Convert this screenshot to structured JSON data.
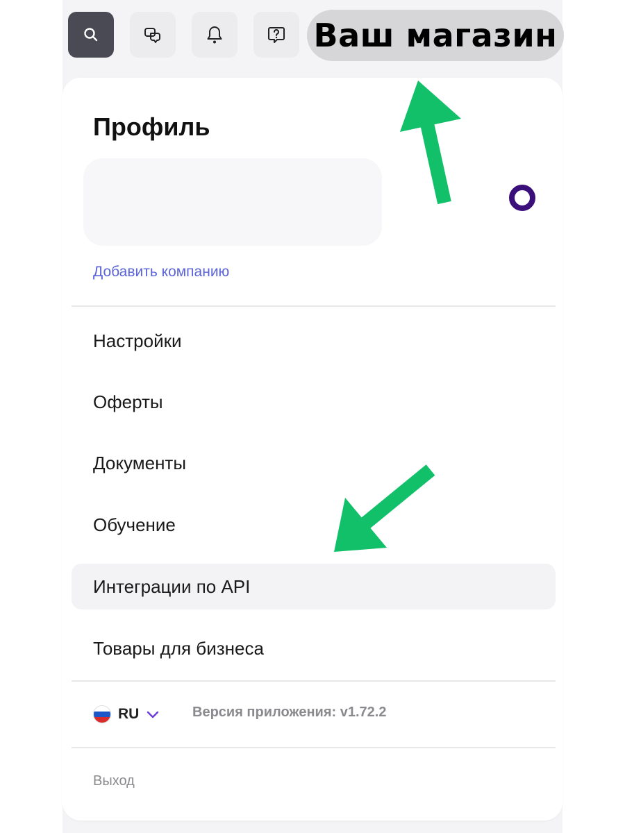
{
  "topbar": {
    "icons": [
      "search-icon",
      "chat-icon",
      "bell-icon",
      "help-icon"
    ],
    "store_label": "Ваш магазин"
  },
  "profile": {
    "title": "Профиль",
    "add_company": "Добавить компанию"
  },
  "menu": {
    "items": [
      {
        "label": "Настройки",
        "highlighted": false
      },
      {
        "label": "Оферты",
        "highlighted": false
      },
      {
        "label": "Документы",
        "highlighted": false
      },
      {
        "label": "Обучение",
        "highlighted": false
      },
      {
        "label": "Интеграции по API",
        "highlighted": true
      },
      {
        "label": "Товары для бизнеса",
        "highlighted": false
      }
    ]
  },
  "footer": {
    "language": "RU",
    "version": "Версия приложения: v1.72.2",
    "logout": "Выход"
  },
  "colors": {
    "accent_link": "#5b64d8",
    "status_ring": "#3b0f7a",
    "annotation_arrow": "#12c06a"
  }
}
